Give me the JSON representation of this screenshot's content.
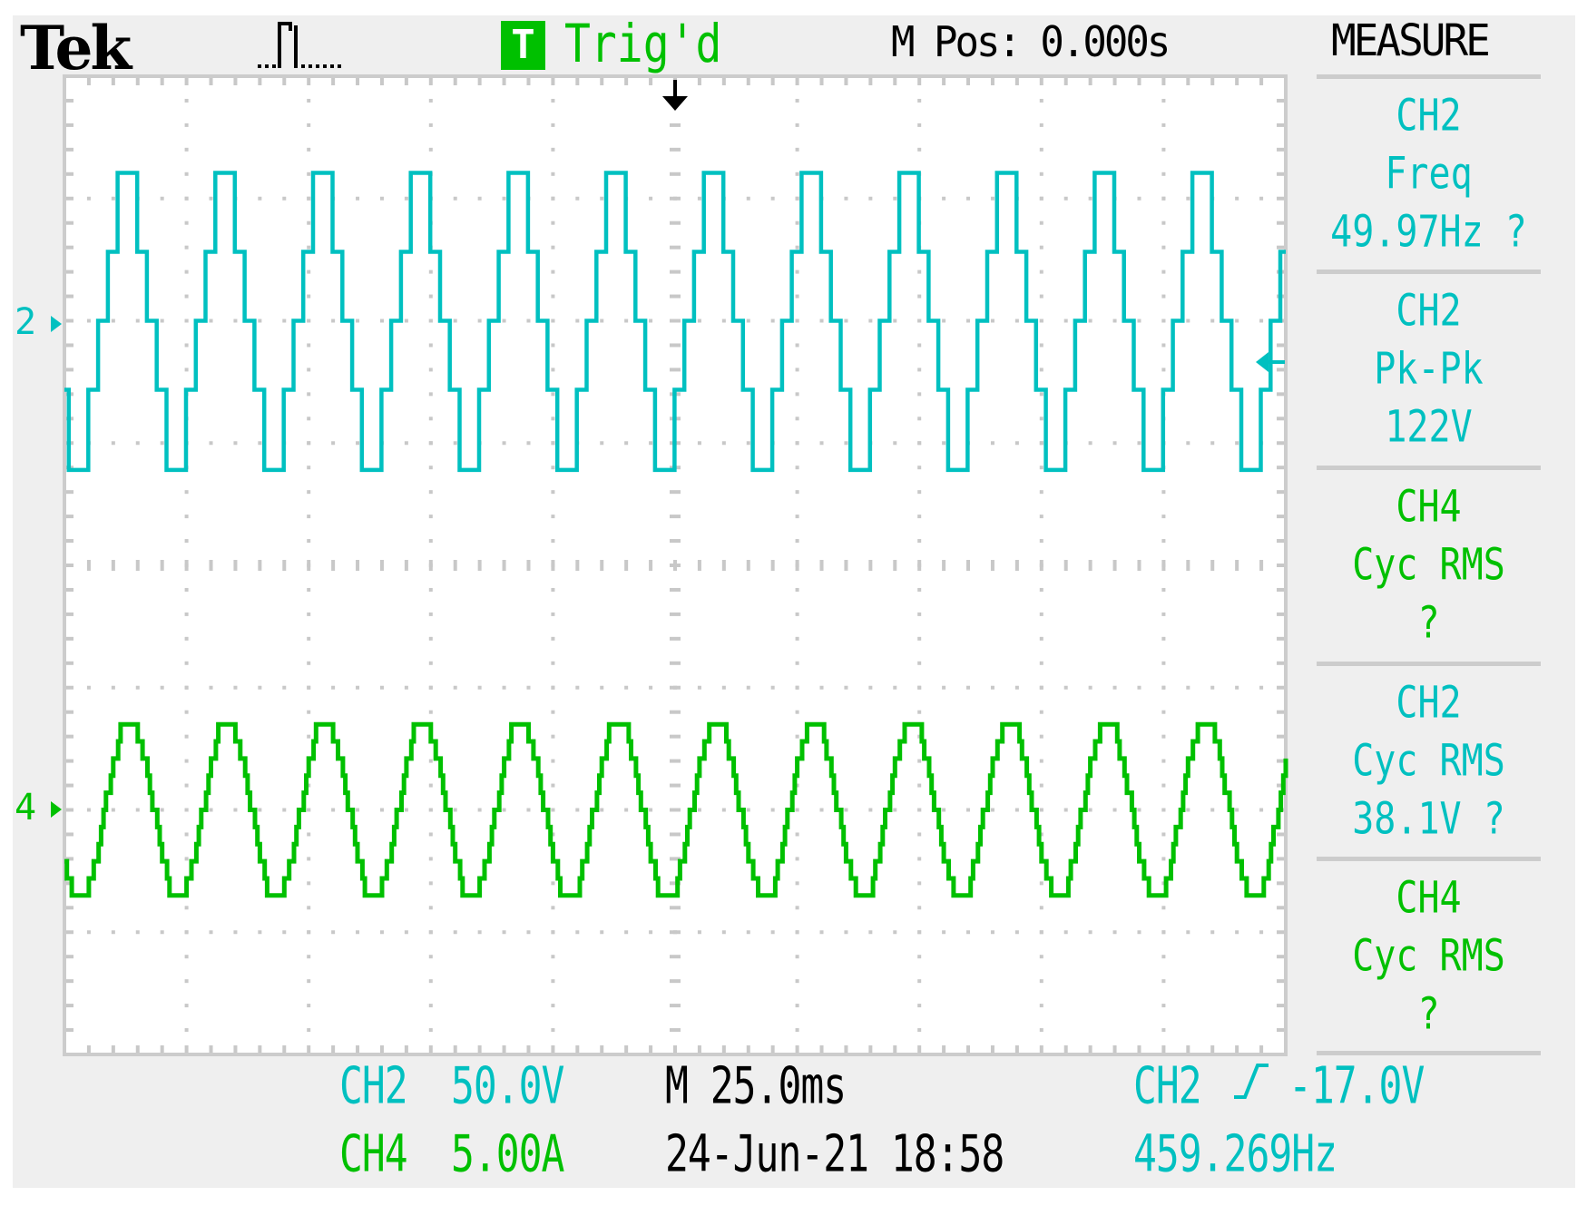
{
  "header": {
    "brand": "Tek",
    "acquisition_icon": "pulse-acquire-icon",
    "trigger_badge": "T",
    "trigger_status": "Trig'd",
    "main_position": "M Pos: 0.000s"
  },
  "measure": {
    "title": "MEASURE",
    "items": [
      {
        "source": "CH2",
        "type": "Freq",
        "value": "49.97Hz ?"
      },
      {
        "source": "CH2",
        "type": "Pk-Pk",
        "value": "122V"
      },
      {
        "source": "CH4",
        "type": "Cyc RMS",
        "value": "?"
      },
      {
        "source": "CH2",
        "type": "Cyc RMS",
        "value": "38.1V ?"
      },
      {
        "source": "CH4",
        "type": "Cyc RMS",
        "value": "?"
      }
    ]
  },
  "footer": {
    "ch2_label": "CH2",
    "ch2_scale": "50.0V",
    "ch4_label": "CH4",
    "ch4_scale": "5.00A",
    "timebase": "M 25.0ms",
    "datetime": "24-Jun-21 18:58",
    "trigger_source": "CH2",
    "trigger_slope_icon": "rising-edge-icon",
    "trigger_level": "-17.0V",
    "trigger_frequency": "459.269Hz"
  },
  "markers": {
    "ch2": "2",
    "ch4": "4"
  },
  "colors": {
    "ch2": "#00c0c0",
    "ch4": "#00c000",
    "grid": "#c8c8c8",
    "panel": "#efefef",
    "screen": "#ffffff"
  },
  "chart_data": {
    "type": "line",
    "title": "",
    "x_unit": "ms",
    "time_per_div_ms": 25,
    "xlim": [
      -125,
      125
    ],
    "trigger_time_ms": 0,
    "grid": true,
    "horizontal_divisions": 10,
    "vertical_divisions": 8,
    "series": [
      {
        "name": "CH2",
        "unit": "V",
        "units_per_div": 50,
        "ylim": [
          -300,
          100
        ],
        "trigger_level": -17,
        "waveform": "stepped",
        "period_ms": 20.01,
        "first_top_start_ms": -114.1,
        "steps": [
          {
            "level": 60.5,
            "duration_ms": 4.0
          },
          {
            "level": 28.2,
            "duration_ms": 2.0
          },
          {
            "level": 0,
            "duration_ms": 2.0
          },
          {
            "level": -28.2,
            "duration_ms": 2.0
          },
          {
            "level": -61.0,
            "duration_ms": 4.0
          },
          {
            "level": -28.2,
            "duration_ms": 2.0
          },
          {
            "level": 0,
            "duration_ms": 2.0
          },
          {
            "level": 28.2,
            "duration_ms": 2.0
          }
        ]
      },
      {
        "name": "CH4",
        "unit": "A",
        "units_per_div": 5,
        "ylim": [
          -10,
          30
        ],
        "waveform": "quantized-sine",
        "period_ms": 20.01,
        "first_peak_ms": -111.8,
        "amplitude": 3.7,
        "offset": 0,
        "quantization": 0.7
      }
    ]
  }
}
